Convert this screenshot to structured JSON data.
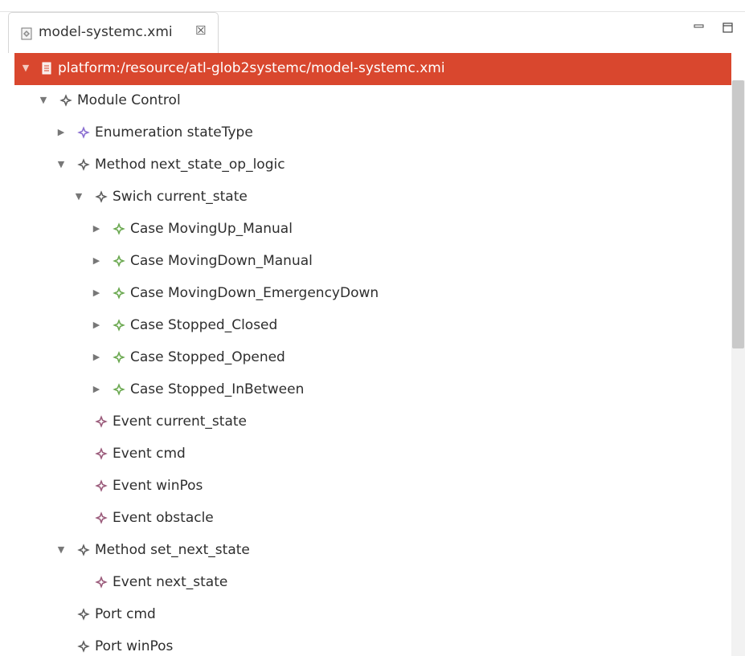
{
  "tab": {
    "title": "model-systemc.xmi",
    "close_glyph": "☒",
    "icon": "xmi-file-icon"
  },
  "view_controls": {
    "minimize_icon": "minimize-icon",
    "maximize_icon": "maximize-icon"
  },
  "colors": {
    "selection": "#d9472e",
    "module_icon": "#5e5e5e",
    "enum_icon": "#8a6fd1",
    "case_icon": "#6aa84f",
    "event_icon": "#9a5a7a"
  },
  "tree": {
    "rows": [
      {
        "label": "platform:/resource/atl-glob2systemc/model-systemc.xmi",
        "toggle": "▼",
        "kind": "resource",
        "selected": true
      },
      {
        "label": "Module Control",
        "toggle": "▼",
        "kind": "module"
      },
      {
        "label": "Enumeration stateType",
        "toggle": "▶",
        "kind": "enum"
      },
      {
        "label": "Method next_state_op_logic",
        "toggle": "▼",
        "kind": "module"
      },
      {
        "label": "Swich current_state",
        "toggle": "▼",
        "kind": "module"
      },
      {
        "label": "Case MovingUp_Manual",
        "toggle": "▶",
        "kind": "case"
      },
      {
        "label": "Case MovingDown_Manual",
        "toggle": "▶",
        "kind": "case"
      },
      {
        "label": "Case MovingDown_EmergencyDown",
        "toggle": "▶",
        "kind": "case"
      },
      {
        "label": "Case Stopped_Closed",
        "toggle": "▶",
        "kind": "case"
      },
      {
        "label": "Case Stopped_Opened",
        "toggle": "▶",
        "kind": "case"
      },
      {
        "label": "Case Stopped_InBetween",
        "toggle": "▶",
        "kind": "case"
      },
      {
        "label": "Event current_state",
        "toggle": "",
        "kind": "event"
      },
      {
        "label": "Event cmd",
        "toggle": "",
        "kind": "event"
      },
      {
        "label": "Event winPos",
        "toggle": "",
        "kind": "event"
      },
      {
        "label": "Event obstacle",
        "toggle": "",
        "kind": "event"
      },
      {
        "label": "Method set_next_state",
        "toggle": "▼",
        "kind": "module"
      },
      {
        "label": "Event next_state",
        "toggle": "",
        "kind": "event"
      },
      {
        "label": "Port cmd",
        "toggle": "",
        "kind": "module"
      },
      {
        "label": "Port winPos",
        "toggle": "",
        "kind": "module"
      }
    ]
  }
}
